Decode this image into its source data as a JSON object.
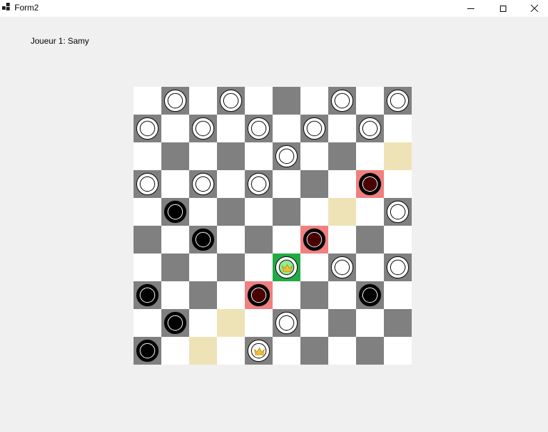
{
  "window": {
    "title": "Form2",
    "icon": "app-window-icon",
    "controls": [
      "minimize-icon",
      "maximize-icon",
      "close-icon"
    ]
  },
  "player_label": "Joueur 1: Samy",
  "colors": {
    "light_square": "#ffffff",
    "dark_square": "#808080",
    "move_target": "#eee3b6",
    "capturable": "#f08080",
    "selected": "#22aa44",
    "crown": "#f2c12e"
  },
  "board": {
    "rows": 10,
    "cols": 10,
    "highlights": [
      {
        "row": 2,
        "col": 9,
        "type": "move-target"
      },
      {
        "row": 3,
        "col": 8,
        "type": "capturable"
      },
      {
        "row": 4,
        "col": 7,
        "type": "move-target"
      },
      {
        "row": 5,
        "col": 6,
        "type": "capturable"
      },
      {
        "row": 6,
        "col": 5,
        "type": "selected"
      },
      {
        "row": 7,
        "col": 4,
        "type": "capturable"
      },
      {
        "row": 8,
        "col": 3,
        "type": "move-target"
      },
      {
        "row": 9,
        "col": 2,
        "type": "move-target"
      }
    ],
    "pieces": [
      {
        "row": 0,
        "col": 1,
        "color": "white",
        "king": false
      },
      {
        "row": 0,
        "col": 3,
        "color": "white",
        "king": false
      },
      {
        "row": 0,
        "col": 7,
        "color": "white",
        "king": false
      },
      {
        "row": 0,
        "col": 9,
        "color": "white",
        "king": false
      },
      {
        "row": 1,
        "col": 0,
        "color": "white",
        "king": false
      },
      {
        "row": 1,
        "col": 2,
        "color": "white",
        "king": false
      },
      {
        "row": 1,
        "col": 4,
        "color": "white",
        "king": false
      },
      {
        "row": 1,
        "col": 6,
        "color": "white",
        "king": false
      },
      {
        "row": 1,
        "col": 8,
        "color": "white",
        "king": false
      },
      {
        "row": 2,
        "col": 5,
        "color": "white",
        "king": false
      },
      {
        "row": 3,
        "col": 0,
        "color": "white",
        "king": false
      },
      {
        "row": 3,
        "col": 2,
        "color": "white",
        "king": false
      },
      {
        "row": 3,
        "col": 4,
        "color": "white",
        "king": false
      },
      {
        "row": 3,
        "col": 8,
        "color": "red",
        "king": false
      },
      {
        "row": 4,
        "col": 1,
        "color": "black",
        "king": false
      },
      {
        "row": 4,
        "col": 9,
        "color": "white",
        "king": false
      },
      {
        "row": 5,
        "col": 2,
        "color": "black",
        "king": false
      },
      {
        "row": 5,
        "col": 6,
        "color": "red",
        "king": false
      },
      {
        "row": 6,
        "col": 5,
        "color": "green",
        "king": true
      },
      {
        "row": 6,
        "col": 7,
        "color": "white",
        "king": false
      },
      {
        "row": 6,
        "col": 9,
        "color": "white",
        "king": false
      },
      {
        "row": 7,
        "col": 0,
        "color": "black",
        "king": false
      },
      {
        "row": 7,
        "col": 4,
        "color": "red",
        "king": false
      },
      {
        "row": 7,
        "col": 8,
        "color": "black",
        "king": false
      },
      {
        "row": 8,
        "col": 1,
        "color": "black",
        "king": false
      },
      {
        "row": 8,
        "col": 5,
        "color": "white",
        "king": false
      },
      {
        "row": 9,
        "col": 0,
        "color": "black",
        "king": false
      },
      {
        "row": 9,
        "col": 4,
        "color": "white",
        "king": true
      }
    ]
  }
}
